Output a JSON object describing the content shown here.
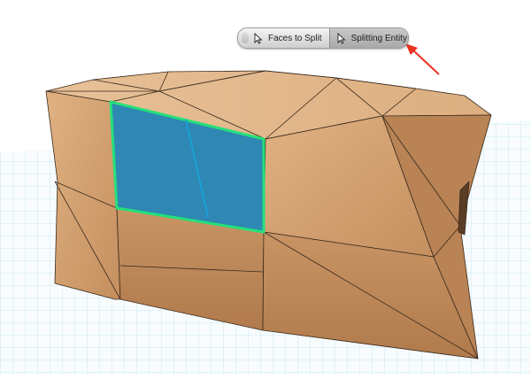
{
  "app": {
    "background_color": "#ffffff",
    "grid_color": "#9fd6ea"
  },
  "toolbar": {
    "items": [
      {
        "label": "Faces to Split",
        "icon": "cursor-arrow-icon",
        "selected": false
      },
      {
        "label": "Splitting Entity",
        "icon": "cursor-arrow-icon",
        "selected": true
      }
    ]
  },
  "colors": {
    "wood": "#d9a878",
    "wood_dark": "#b98355",
    "selection_fill": "#2f87b3",
    "selection_outline": "#24e07a",
    "split_line": "#1aa0d6",
    "annotation_arrow": "#e8321f"
  }
}
